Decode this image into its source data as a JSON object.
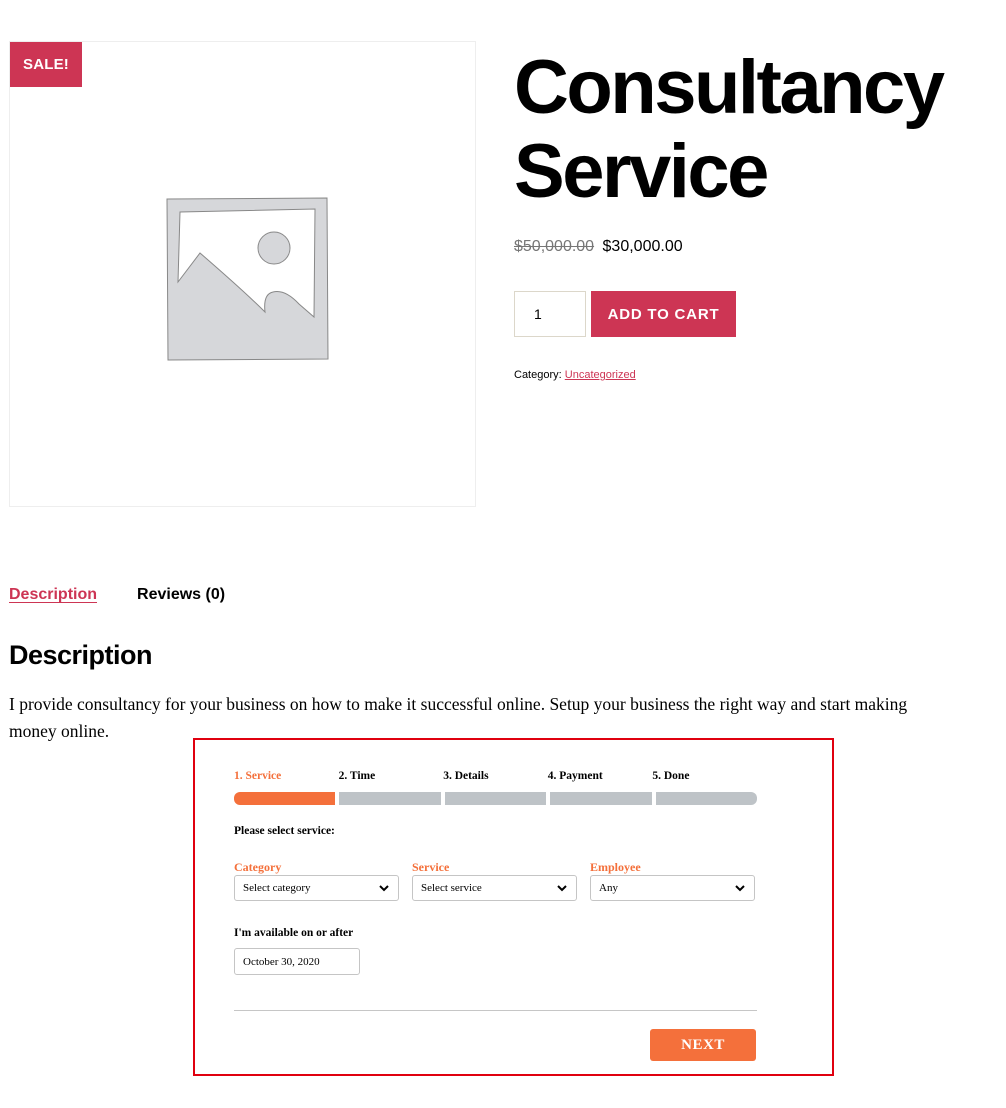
{
  "product": {
    "sale_badge": "SALE!",
    "title_line1": "Consultancy",
    "title_line2": "Service",
    "price_old": "$50,000.00",
    "price_new": "$30,000.00",
    "quantity": "1",
    "add_to_cart_label": "ADD TO CART",
    "category_label": "Category:",
    "category_link": "Uncategorized",
    "image_alt": "placeholder-image"
  },
  "tabs": [
    {
      "label": "Description",
      "active": true
    },
    {
      "label": "Reviews (0)",
      "active": false
    }
  ],
  "description": {
    "heading": "Description",
    "text": "I provide consultancy for your business on how to make it successful online. Setup your business the right way and start making money online."
  },
  "booking": {
    "steps": [
      {
        "label": "1. Service",
        "active": true
      },
      {
        "label": "2. Time",
        "active": false
      },
      {
        "label": "3. Details",
        "active": false
      },
      {
        "label": "4. Payment",
        "active": false
      },
      {
        "label": "5. Done",
        "active": false
      }
    ],
    "progress_step": 1,
    "progress_total": 5,
    "select_title": "Please select service:",
    "fields": [
      {
        "label": "Category",
        "value": "Select category"
      },
      {
        "label": "Service",
        "value": "Select service"
      },
      {
        "label": "Employee",
        "value": "Any"
      }
    ],
    "available_label": "I'm available on or after",
    "available_date": "October 30, 2020",
    "next_label": "NEXT"
  },
  "colors": {
    "brand": "#cd3554",
    "booking_accent": "#f4703b",
    "frame_highlight": "#e0000f"
  }
}
